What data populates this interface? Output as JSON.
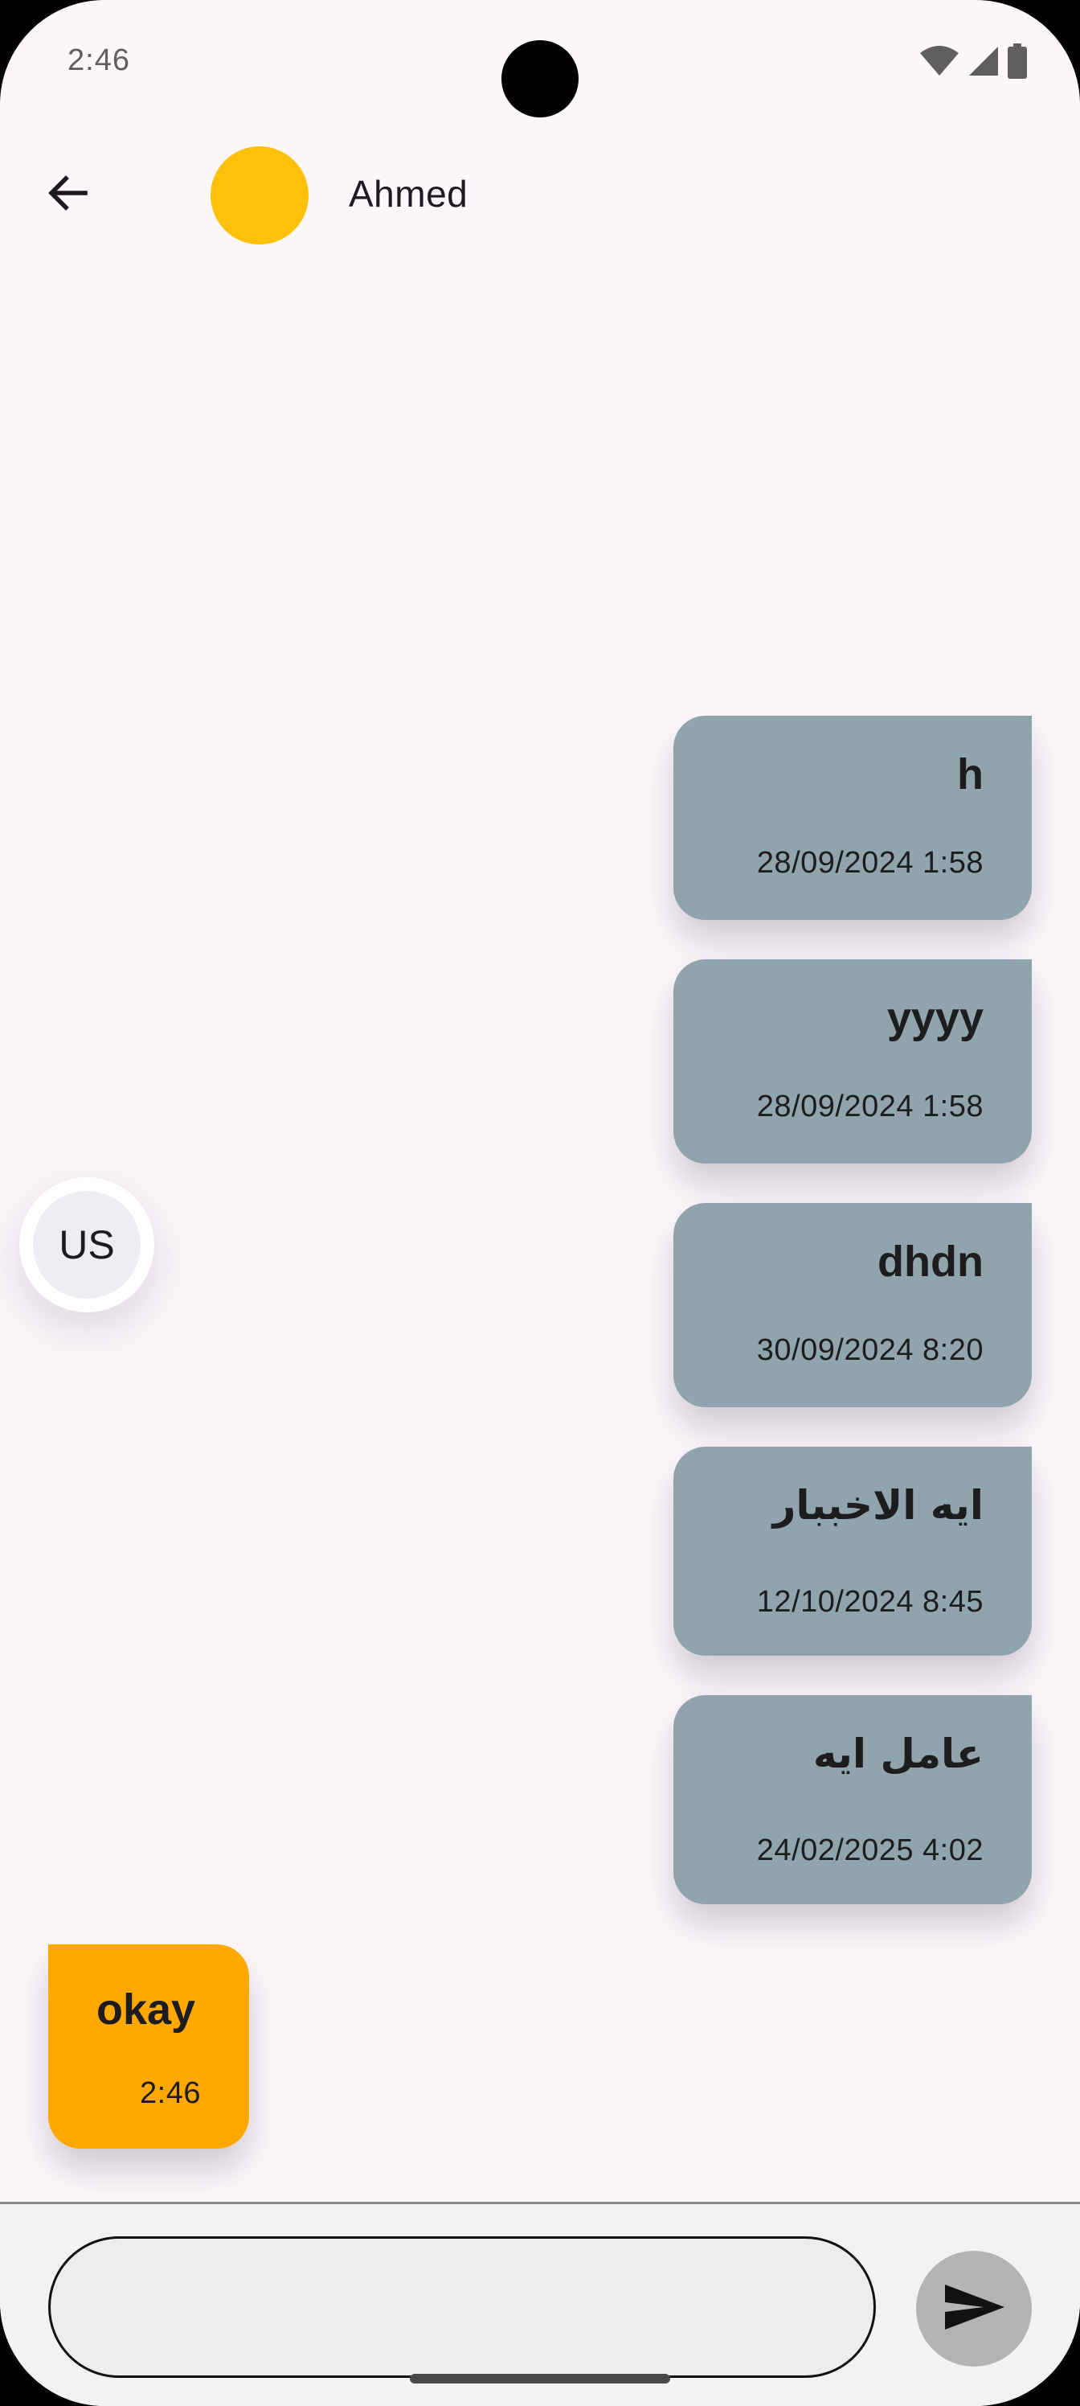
{
  "status_bar": {
    "time": "2:46",
    "icons": [
      "wifi-icon",
      "cell-signal-icon",
      "battery-icon"
    ]
  },
  "app_bar": {
    "back_icon": "arrow-left-icon",
    "contact_name": "Ahmed",
    "avatar_color": "#ffc107"
  },
  "floating_chip": {
    "label": "US"
  },
  "messages": [
    {
      "direction": "sent",
      "text": "h",
      "time": "28/09/2024 1:58"
    },
    {
      "direction": "sent",
      "text": "yyyy",
      "time": "28/09/2024 1:58"
    },
    {
      "direction": "sent",
      "text": "dhdn",
      "time": "30/09/2024 8:20"
    },
    {
      "direction": "sent",
      "text": "ايه الاخببار",
      "time": "12/10/2024 8:45"
    },
    {
      "direction": "sent",
      "text": "عامل ايه",
      "time": "24/02/2025 4:02"
    },
    {
      "direction": "received",
      "text": "okay",
      "time": "2:46"
    }
  ],
  "composer": {
    "value": "",
    "placeholder": "",
    "send_icon": "send-icon"
  },
  "colors": {
    "background": "#fdf7fb",
    "sent_bubble": "#90a4ae",
    "received_bubble": "#ffa800",
    "send_button": "#b4b4b4"
  }
}
